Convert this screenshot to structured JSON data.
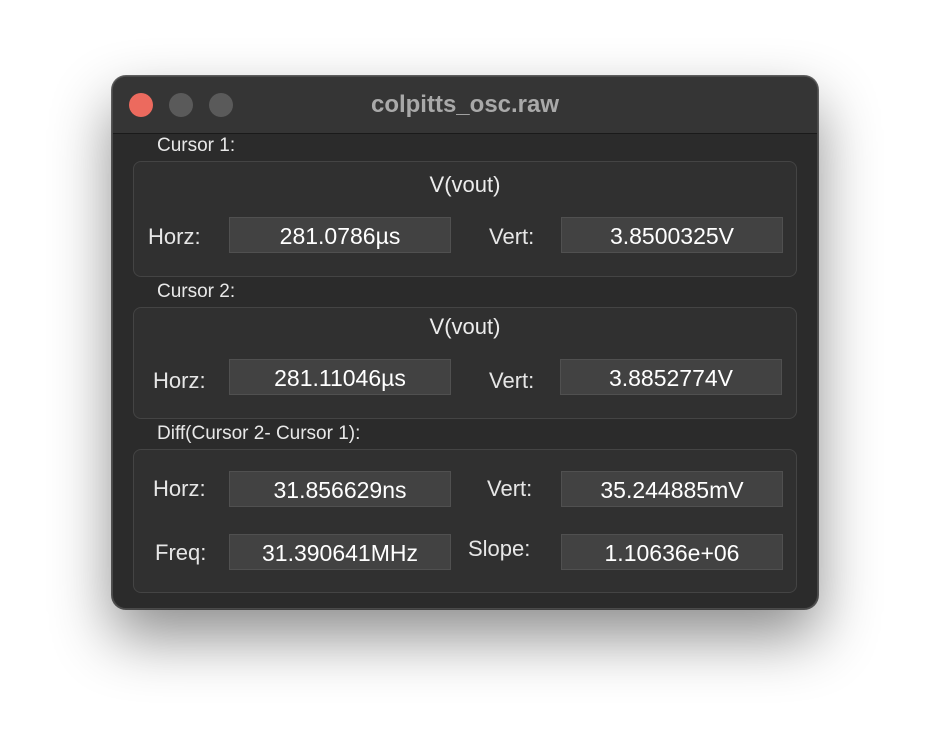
{
  "window": {
    "title": "colpitts_osc.raw"
  },
  "cursor1": {
    "label": "Cursor 1:",
    "signal": "V(vout)",
    "horz_label": "Horz:",
    "horz_value": "281.0786µs",
    "vert_label": "Vert:",
    "vert_value": "3.8500325V"
  },
  "cursor2": {
    "label": "Cursor 2:",
    "signal": "V(vout)",
    "horz_label": "Horz:",
    "horz_value": "281.11046µs",
    "vert_label": "Vert:",
    "vert_value": "3.8852774V"
  },
  "diff": {
    "label": "Diff(Cursor 2- Cursor 1):",
    "horz_label": "Horz:",
    "horz_value": "31.856629ns",
    "vert_label": "Vert:",
    "vert_value": "35.244885mV",
    "freq_label": "Freq:",
    "freq_value": "31.390641MHz",
    "slope_label": "Slope:",
    "slope_value": "1.10636e+06"
  }
}
